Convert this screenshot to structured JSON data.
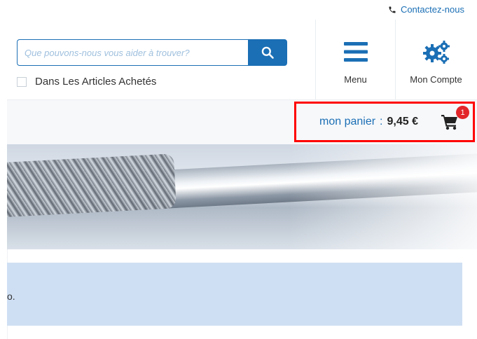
{
  "topbar": {
    "contact_label": "Contactez-nous"
  },
  "search": {
    "placeholder": "Que pouvons-nous vous aider à trouver?",
    "value": ""
  },
  "filter": {
    "purchased_label": "Dans Les Articles Achetés",
    "checked": false
  },
  "nav": {
    "menu_label": "Menu",
    "account_label": "Mon Compte"
  },
  "cart": {
    "label": "mon panier",
    "separator": ":",
    "total": "9,45 €",
    "count": "1"
  },
  "info": {
    "text": "o."
  },
  "colors": {
    "brand_blue": "#1b6fb5",
    "highlight_red": "#ff0000",
    "badge_red": "#e2262a",
    "info_bg": "#cfdff3"
  },
  "icons": {
    "phone": "phone-icon",
    "search": "search-icon",
    "menu": "hamburger-menu-icon",
    "account": "gears-icon",
    "cart": "cart-icon"
  }
}
